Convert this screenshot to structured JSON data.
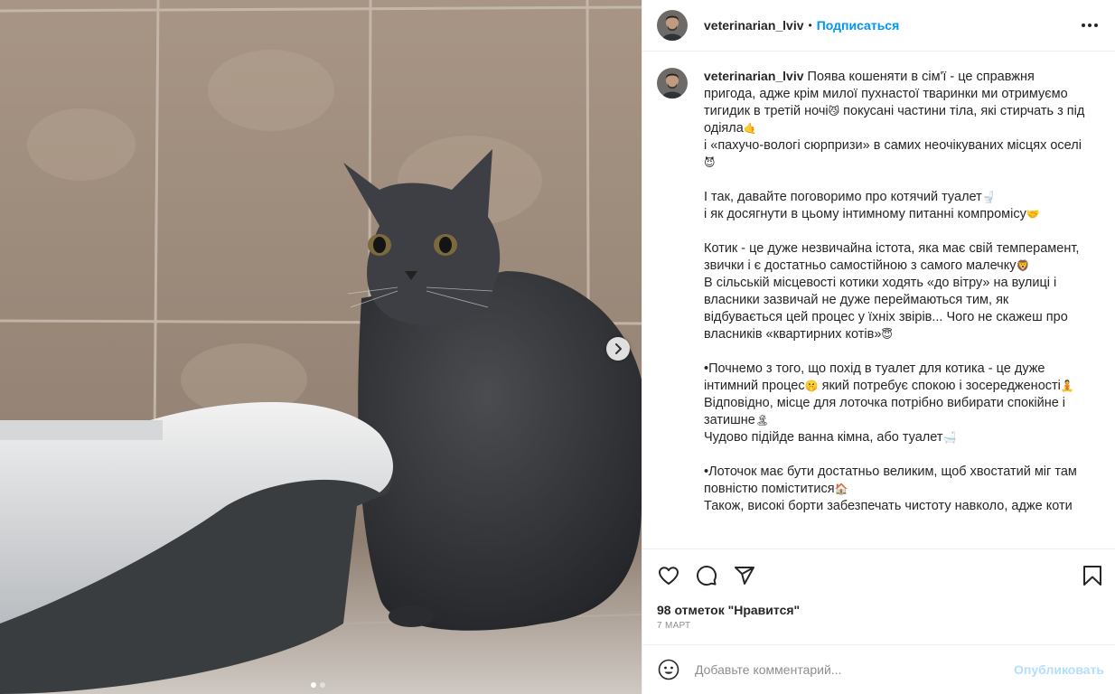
{
  "post": {
    "author": {
      "username": "veterinarian_lviv",
      "avatar_icon": "user-avatar-icon"
    },
    "follow_label": "Подписаться",
    "separator": "•",
    "more_icon": "more-horizontal-icon",
    "media": {
      "image_icon": "cat-photo",
      "next_icon": "chevron-right-icon",
      "slides_count": 2,
      "active_slide": 1
    },
    "caption": {
      "username": "veterinarian_lviv",
      "paragraphs": [
        [
          "Поява кошеняти в сім'ї - це справжня пригода, адже крім милої пухнастої тваринки ми отримуємо тигидик в третій ночі",
          "😼",
          " покусані частини тіла, які стирчать з під одіяла",
          "🤙"
        ],
        [
          "і «пахучо-вологі сюрпризи» в самих неочікуваних місцях оселі",
          "😈"
        ],
        [],
        [
          "І так, давайте поговоримо про котячий туалет",
          "🚽"
        ],
        [
          "і як досягнути в цьому інтимному питанні компромісу",
          "🤝"
        ],
        [],
        [
          "Котик - це дуже незвичайна істота, яка має свій темперамент, звички і є достатньо самостійною з самого малечку",
          "🦁"
        ],
        [
          "В сільській місцевості котики ходять «до вітру» на вулиці і власники зазвичай не дуже переймаються тим, як відбувається цей процес у їхніх звірів... Чого не скажеш про власників «квартирних котів»",
          "😇"
        ],
        [],
        [
          "•Почнемо з того, що похід в туалет для котика - це дуже інтимний процес",
          "🤫",
          " який потребує спокою і зосередженості",
          "🧘"
        ],
        [
          "Відповідно, місце для лоточка потрібно вибирати спокійне і затишне",
          "🏝"
        ],
        [
          "Чудово підійде ванна кімна, або туалет",
          "🛁"
        ],
        [],
        [
          "•Лоточок має бути достатньо великим, щоб хвостатий міг там повністю поміститися",
          "🏠"
        ],
        [
          "Також, високі борти забезпечать чистоту навколо, адже коти"
        ]
      ]
    },
    "actions": {
      "like_icon": "heart-icon",
      "comment_icon": "comment-icon",
      "share_icon": "share-icon",
      "save_icon": "bookmark-icon"
    },
    "likes_text": "98 отметок \"Нравится\"",
    "date_text": "7 МАРТ",
    "comment": {
      "emoji_icon": "smiley-icon",
      "placeholder": "Добавьте комментарий...",
      "value": "",
      "post_label": "Опубликовать"
    }
  }
}
